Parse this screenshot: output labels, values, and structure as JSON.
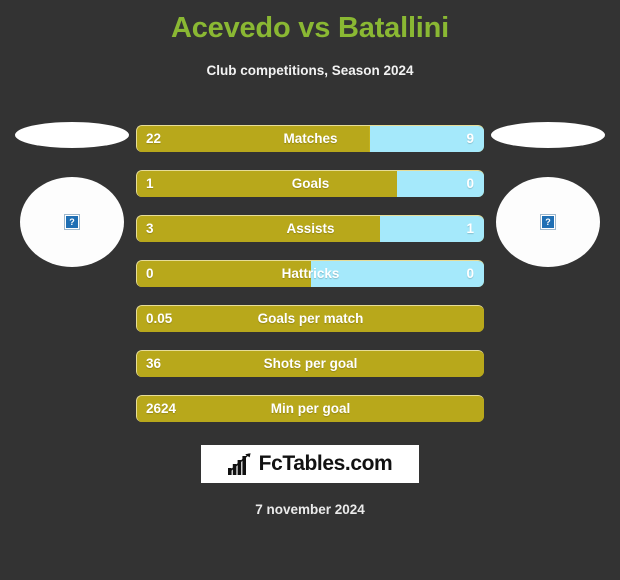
{
  "header": {
    "title": "Acevedo vs Batallini",
    "subtitle": "Club competitions, Season 2024",
    "title_color": "#8ab833"
  },
  "players": {
    "home": {
      "name": "",
      "photo_icon": "broken-image-icon",
      "photo_icon_glyph": "?"
    },
    "away": {
      "name": "",
      "photo_icon": "broken-image-icon",
      "photo_icon_glyph": "?"
    }
  },
  "colors": {
    "background": "#333333",
    "home_bar": "#b8a81b",
    "away_bar": "#a5e9fb",
    "bar_border": "#e6dc97",
    "accent_title": "#8ab833",
    "text": "#ffffff"
  },
  "chart_data": {
    "type": "bar",
    "title": "Acevedo vs Batallini",
    "subtitle": "Club competitions, Season 2024",
    "orientation": "horizontal-diverging",
    "series": [
      {
        "name": "Acevedo",
        "color": "#b8a81b",
        "side": "left"
      },
      {
        "name": "Batallini",
        "color": "#a5e9fb",
        "side": "right"
      }
    ],
    "categories": [
      "Matches",
      "Goals",
      "Assists",
      "Hattricks",
      "Goals per match",
      "Shots per goal",
      "Min per goal"
    ],
    "rows": [
      {
        "label": "Matches",
        "home_value": "22",
        "away_value": "9",
        "home_pct": 67,
        "away_pct": 33,
        "split": true
      },
      {
        "label": "Goals",
        "home_value": "1",
        "away_value": "0",
        "home_pct": 75,
        "away_pct": 25,
        "split": true
      },
      {
        "label": "Assists",
        "home_value": "3",
        "away_value": "1",
        "home_pct": 70,
        "away_pct": 30,
        "split": true
      },
      {
        "label": "Hattricks",
        "home_value": "0",
        "away_value": "0",
        "home_pct": 50,
        "away_pct": 50,
        "split": true
      },
      {
        "label": "Goals per match",
        "home_value": "0.05",
        "away_value": "",
        "home_pct": 100,
        "away_pct": 0,
        "split": false
      },
      {
        "label": "Shots per goal",
        "home_value": "36",
        "away_value": "",
        "home_pct": 100,
        "away_pct": 0,
        "split": false
      },
      {
        "label": "Min per goal",
        "home_value": "2624",
        "away_value": "",
        "home_pct": 100,
        "away_pct": 0,
        "split": false
      }
    ]
  },
  "footer": {
    "logo_text": "FcTables.com",
    "logo_icon": "bar-chart-growth-icon",
    "date": "7 november 2024"
  }
}
